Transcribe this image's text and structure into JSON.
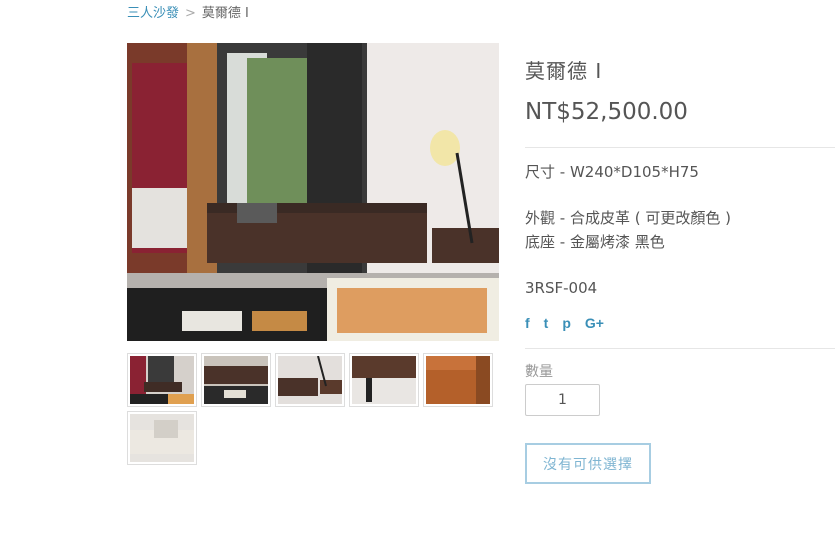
{
  "breadcrumb": {
    "parent": "三人沙發",
    "separator": ">",
    "current": "莫爾德 I"
  },
  "product": {
    "title": "莫爾德 I",
    "price": "NT$52,500.00",
    "size": "尺寸 - W240*D105*H75",
    "exterior": "外觀 - 合成皮革 ( 可更改顏色 )",
    "base": "底座 - 金屬烤漆  黑色",
    "sku": "3RSF-004"
  },
  "social": {
    "facebook": "f",
    "twitter": "t",
    "pinterest": "p",
    "google": "G+"
  },
  "purchase": {
    "quantity_label": "數量",
    "quantity_value": "1",
    "button_label": "沒有可供選擇"
  },
  "icons": [
    "facebook-icon",
    "twitter-icon",
    "pinterest-icon",
    "google-plus-icon"
  ],
  "colors": {
    "link": "#3a8fb7",
    "text": "#555555",
    "button_border": "#a7cde2"
  }
}
